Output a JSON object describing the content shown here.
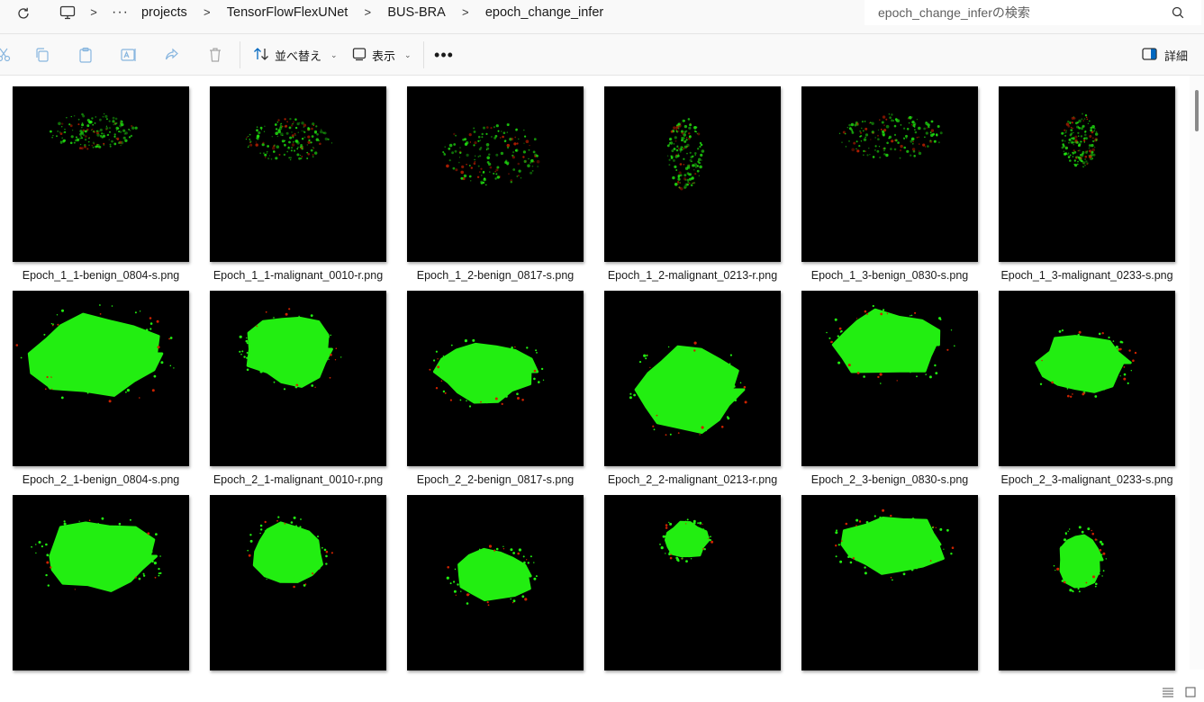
{
  "address": {
    "more": "···",
    "separator": ">",
    "crumbs": [
      "projects",
      "TensorFlowFlexUNet",
      "BUS-BRA",
      "epoch_change_infer"
    ]
  },
  "search": {
    "placeholder": "epoch_change_inferの検索"
  },
  "toolbar": {
    "sort_label": "並べ替え",
    "view_label": "表示",
    "more": "•••",
    "details_label": "詳細"
  },
  "files": [
    {
      "name": "Epoch_1_1-benign_0804-s.png",
      "mask": "sparse"
    },
    {
      "name": "Epoch_1_1-malignant_0010-r.png",
      "mask": "sparse"
    },
    {
      "name": "Epoch_1_2-benign_0817-s.png",
      "mask": "sparse"
    },
    {
      "name": "Epoch_1_2-malignant_0213-r.png",
      "mask": "sparse"
    },
    {
      "name": "Epoch_1_3-benign_0830-s.png",
      "mask": "sparse"
    },
    {
      "name": "Epoch_1_3-malignant_0233-s.png",
      "mask": "sparse"
    },
    {
      "name": "Epoch_2_1-benign_0804-s.png",
      "mask": "blob"
    },
    {
      "name": "Epoch_2_1-malignant_0010-r.png",
      "mask": "blob"
    },
    {
      "name": "Epoch_2_2-benign_0817-s.png",
      "mask": "blob"
    },
    {
      "name": "Epoch_2_2-malignant_0213-r.png",
      "mask": "blob"
    },
    {
      "name": "Epoch_2_3-benign_0830-s.png",
      "mask": "blob"
    },
    {
      "name": "Epoch_2_3-malignant_0233-s.png",
      "mask": "blob"
    },
    {
      "name": "",
      "mask": "blob"
    },
    {
      "name": "",
      "mask": "blob"
    },
    {
      "name": "",
      "mask": "blob"
    },
    {
      "name": "",
      "mask": "blob"
    },
    {
      "name": "",
      "mask": "blob"
    },
    {
      "name": "",
      "mask": "blob"
    }
  ],
  "colors": {
    "mask": "#22ee11",
    "noise": "#cc2200",
    "thumb_bg": "#000000",
    "accent": "#0067c0"
  }
}
